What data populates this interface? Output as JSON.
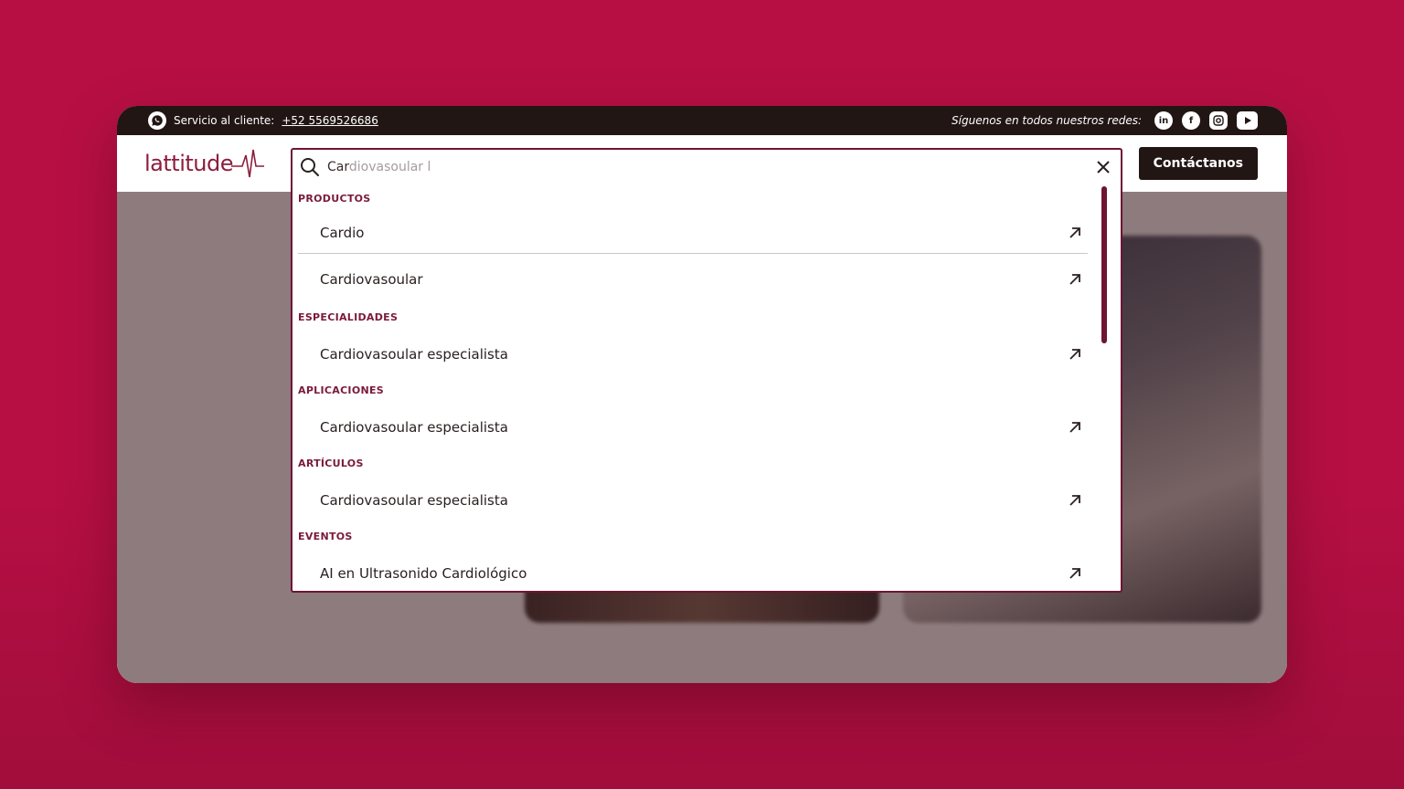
{
  "topbar": {
    "service_label": "Servicio al cliente:",
    "phone": "+52 5569526686",
    "follow_label": "Síguenos en todos nuestros redes:",
    "socials": [
      "linkedin-icon",
      "facebook-icon",
      "instagram-icon",
      "youtube-icon"
    ]
  },
  "navbar": {
    "logo_text": "lattitude",
    "contact_label": "Contáctanos"
  },
  "search": {
    "typed": "Car",
    "suggestion_rest": "diovasoular l",
    "value": "Cardiovasoular l",
    "groups": [
      {
        "label": "PRODUCTOS",
        "items": [
          "Cardio",
          "Cardiovasoular"
        ]
      },
      {
        "label": "ESPECIALIDADES",
        "items": [
          "Cardiovasoular especialista"
        ]
      },
      {
        "label": "APLICACIONES",
        "items": [
          "Cardiovasoular especialista"
        ]
      },
      {
        "label": "ARTÍCULOS",
        "items": [
          "Cardiovasoular especialista"
        ]
      },
      {
        "label": "EVENTOS",
        "items": [
          "AI en Ultrasonido Cardiológico"
        ]
      }
    ]
  },
  "colors": {
    "background": "#b70f44",
    "accent": "#6e1434",
    "dark": "#221615"
  }
}
